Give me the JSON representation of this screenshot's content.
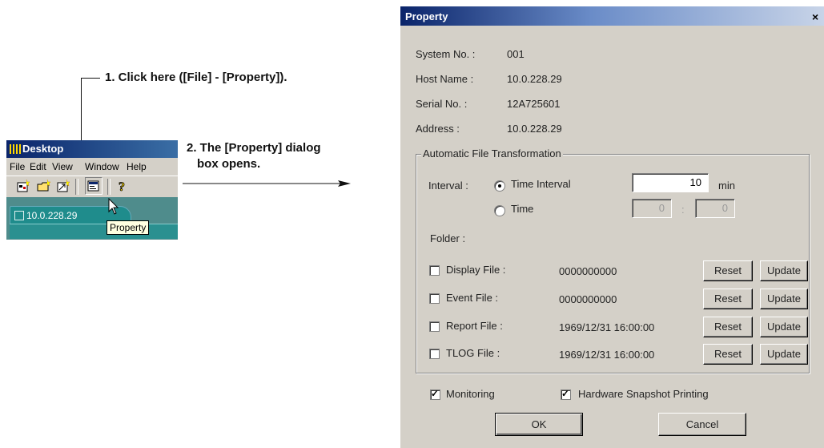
{
  "callouts": {
    "step1": "1. Click here ([File] - [Property]).",
    "step2_line1": "2. The [Property] dialog",
    "step2_line2": "box opens."
  },
  "desktop_window": {
    "title": "Desktop",
    "menu": [
      "File",
      "Edit",
      "View",
      "Window",
      "Help"
    ],
    "tab_label": "10.0.228.29",
    "tooltip": "Property",
    "toolbar_icons": [
      "new-desktop-icon",
      "open-folder-icon",
      "import-icon",
      "property-icon",
      "help-icon"
    ]
  },
  "dialog": {
    "title": "Property",
    "close_glyph": "×",
    "info": [
      {
        "label": "System No. :",
        "value": "001"
      },
      {
        "label": "Host Name :",
        "value": "10.0.228.29"
      },
      {
        "label": "Serial No. :",
        "value": "12A725601"
      },
      {
        "label": "Address :",
        "value": "10.0.228.29"
      }
    ],
    "group_title": "Automatic File Transformation",
    "interval_label": "Interval :",
    "radio_time_interval": "Time Interval",
    "radio_time": "Time",
    "interval_value": "10",
    "interval_unit": "min",
    "time_hour": "0",
    "time_sep": ":",
    "time_minute": "0",
    "folder_label": "Folder :",
    "files": [
      {
        "label": "Display File :",
        "value": "0000000000",
        "checked": false
      },
      {
        "label": "Event File :",
        "value": "0000000000",
        "checked": false
      },
      {
        "label": "Report File :",
        "value": "1969/12/31 16:00:00",
        "checked": false
      },
      {
        "label": "TLOG File :",
        "value": "1969/12/31 16:00:00",
        "checked": false
      }
    ],
    "reset_label": "Reset",
    "update_label": "Update",
    "monitoring_label": "Monitoring",
    "monitoring_checked": true,
    "snapshot_label": "Hardware Snapshot Printing",
    "snapshot_checked": true,
    "ok_label": "OK",
    "cancel_label": "Cancel"
  }
}
